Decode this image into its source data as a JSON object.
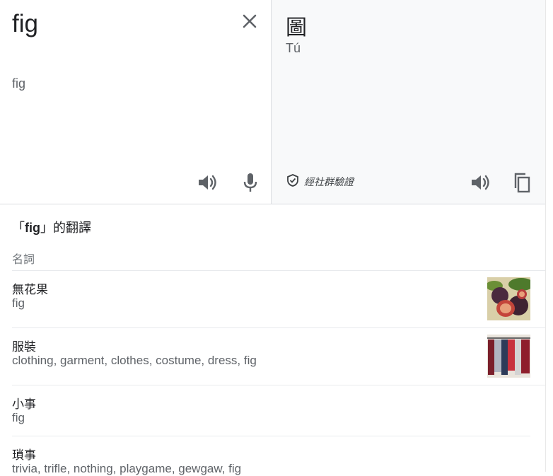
{
  "source": {
    "text": "fig",
    "echo": "fig",
    "icons": {
      "close": "close-icon",
      "speak": "speaker-icon",
      "mic": "microphone-icon"
    }
  },
  "target": {
    "text": "圖",
    "romanization": "Tú",
    "verified_label": "經社群驗證",
    "icons": {
      "verified": "shield-check-icon",
      "speak": "speaker-icon",
      "copy": "copy-icon"
    }
  },
  "translations": {
    "heading_prefix": "「",
    "heading_term": "fig",
    "heading_suffix": "」的翻譯",
    "part_of_speech": "名詞",
    "entries": [
      {
        "word": "無花果",
        "synonyms": "fig"
      },
      {
        "word": "服裝",
        "synonyms": "clothing, garment, clothes, costume, dress, fig"
      },
      {
        "word": "小事",
        "synonyms": "fig"
      },
      {
        "word": "瑣事",
        "synonyms": "trivia, trifle, nothing, playgame, gewgaw, fig"
      }
    ]
  },
  "colors": {
    "accent_text": "#202124",
    "secondary_text": "#5f6368",
    "icon": "#5f6368",
    "target_bg": "#f8f9fa",
    "divider": "#dadce0"
  }
}
